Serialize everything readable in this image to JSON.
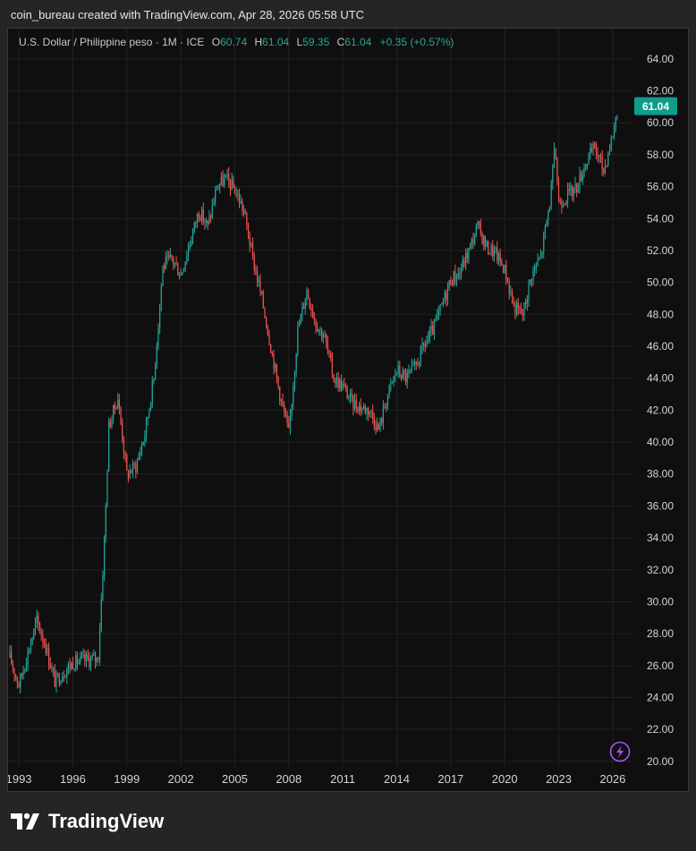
{
  "caption": "coin_bureau created with TradingView.com, Apr 28, 2026 05:58 UTC",
  "legend": {
    "symbol": "U.S. Dollar / Philippine peso · 1M · ICE",
    "open_label": "O",
    "open": "60.74",
    "high_label": "H",
    "high": "61.04",
    "low_label": "L",
    "low": "59.35",
    "close_label": "C",
    "close": "61.04",
    "change": "+0.35 (+0.57%)"
  },
  "brand": {
    "name": "TradingView",
    "icon": "tradingview-logo-icon"
  },
  "bolt_icon": "lightning-icon",
  "colors": {
    "up": "#26a69a",
    "down": "#ef5350",
    "price_tag": "#0f9d8a",
    "grid": "#222222",
    "axis_text": "#d1d4dc",
    "bolt": "#a855f7"
  },
  "chart_data": {
    "type": "candlestick",
    "title": "",
    "x_tick_labels": [
      "1993",
      "1996",
      "1999",
      "2002",
      "2005",
      "2008",
      "2011",
      "2014",
      "2017",
      "2020",
      "2023",
      "2026"
    ],
    "y_tick_labels": [
      "64.00",
      "62.00",
      "60.00",
      "58.00",
      "56.00",
      "54.00",
      "52.00",
      "50.00",
      "48.00",
      "46.00",
      "44.00",
      "42.00",
      "40.00",
      "38.00",
      "36.00",
      "34.00",
      "32.00",
      "30.00",
      "28.00",
      "26.00",
      "24.00",
      "22.00",
      "20.00"
    ],
    "xlim": [
      1992.4,
      2027.1
    ],
    "ylim": [
      19.6,
      65.0
    ],
    "last_price": "61.04",
    "grid": true,
    "series": [
      {
        "interval": "1M",
        "x": [
          1992.5,
          1993.0,
          1993.5,
          1994.0,
          1994.5,
          1995.0,
          1995.5,
          1996.0,
          1996.5,
          1997.0,
          1997.4,
          1997.6,
          1997.8,
          1998.0,
          1998.5,
          1999.0,
          1999.5,
          2000.0,
          2000.5,
          2001.0,
          2001.5,
          2002.0,
          2002.5,
          2003.0,
          2003.5,
          2004.0,
          2004.5,
          2005.0,
          2005.5,
          2006.0,
          2006.5,
          2007.0,
          2007.5,
          2008.0,
          2008.5,
          2009.0,
          2009.5,
          2010.0,
          2010.5,
          2011.0,
          2011.5,
          2012.0,
          2012.5,
          2013.0,
          2013.5,
          2014.0,
          2014.5,
          2015.0,
          2015.5,
          2016.0,
          2016.5,
          2017.0,
          2017.5,
          2018.0,
          2018.5,
          2019.0,
          2019.5,
          2020.0,
          2020.5,
          2021.0,
          2021.5,
          2022.0,
          2022.5,
          2022.8,
          2023.0,
          2023.5,
          2024.0,
          2024.5,
          2025.0,
          2025.5,
          2026.0,
          2026.3
        ],
        "close": [
          26.5,
          24.8,
          26.8,
          28.8,
          27.2,
          25.0,
          25.6,
          26.2,
          26.3,
          26.4,
          26.4,
          30.5,
          35.0,
          41.0,
          42.8,
          38.0,
          38.5,
          40.5,
          44.0,
          51.0,
          51.5,
          50.5,
          52.5,
          54.5,
          53.5,
          56.0,
          56.5,
          55.8,
          54.5,
          51.5,
          49.0,
          46.0,
          43.0,
          40.5,
          47.0,
          49.5,
          47.5,
          46.5,
          44.0,
          43.5,
          42.5,
          42.2,
          42.0,
          40.8,
          43.0,
          44.5,
          44.0,
          44.6,
          46.0,
          47.0,
          48.5,
          50.2,
          50.6,
          52.0,
          53.5,
          52.2,
          51.8,
          50.8,
          48.5,
          48.0,
          50.5,
          51.6,
          55.0,
          58.5,
          55.0,
          55.5,
          56.0,
          57.5,
          58.5,
          57.0,
          59.3,
          61.04
        ]
      }
    ]
  }
}
